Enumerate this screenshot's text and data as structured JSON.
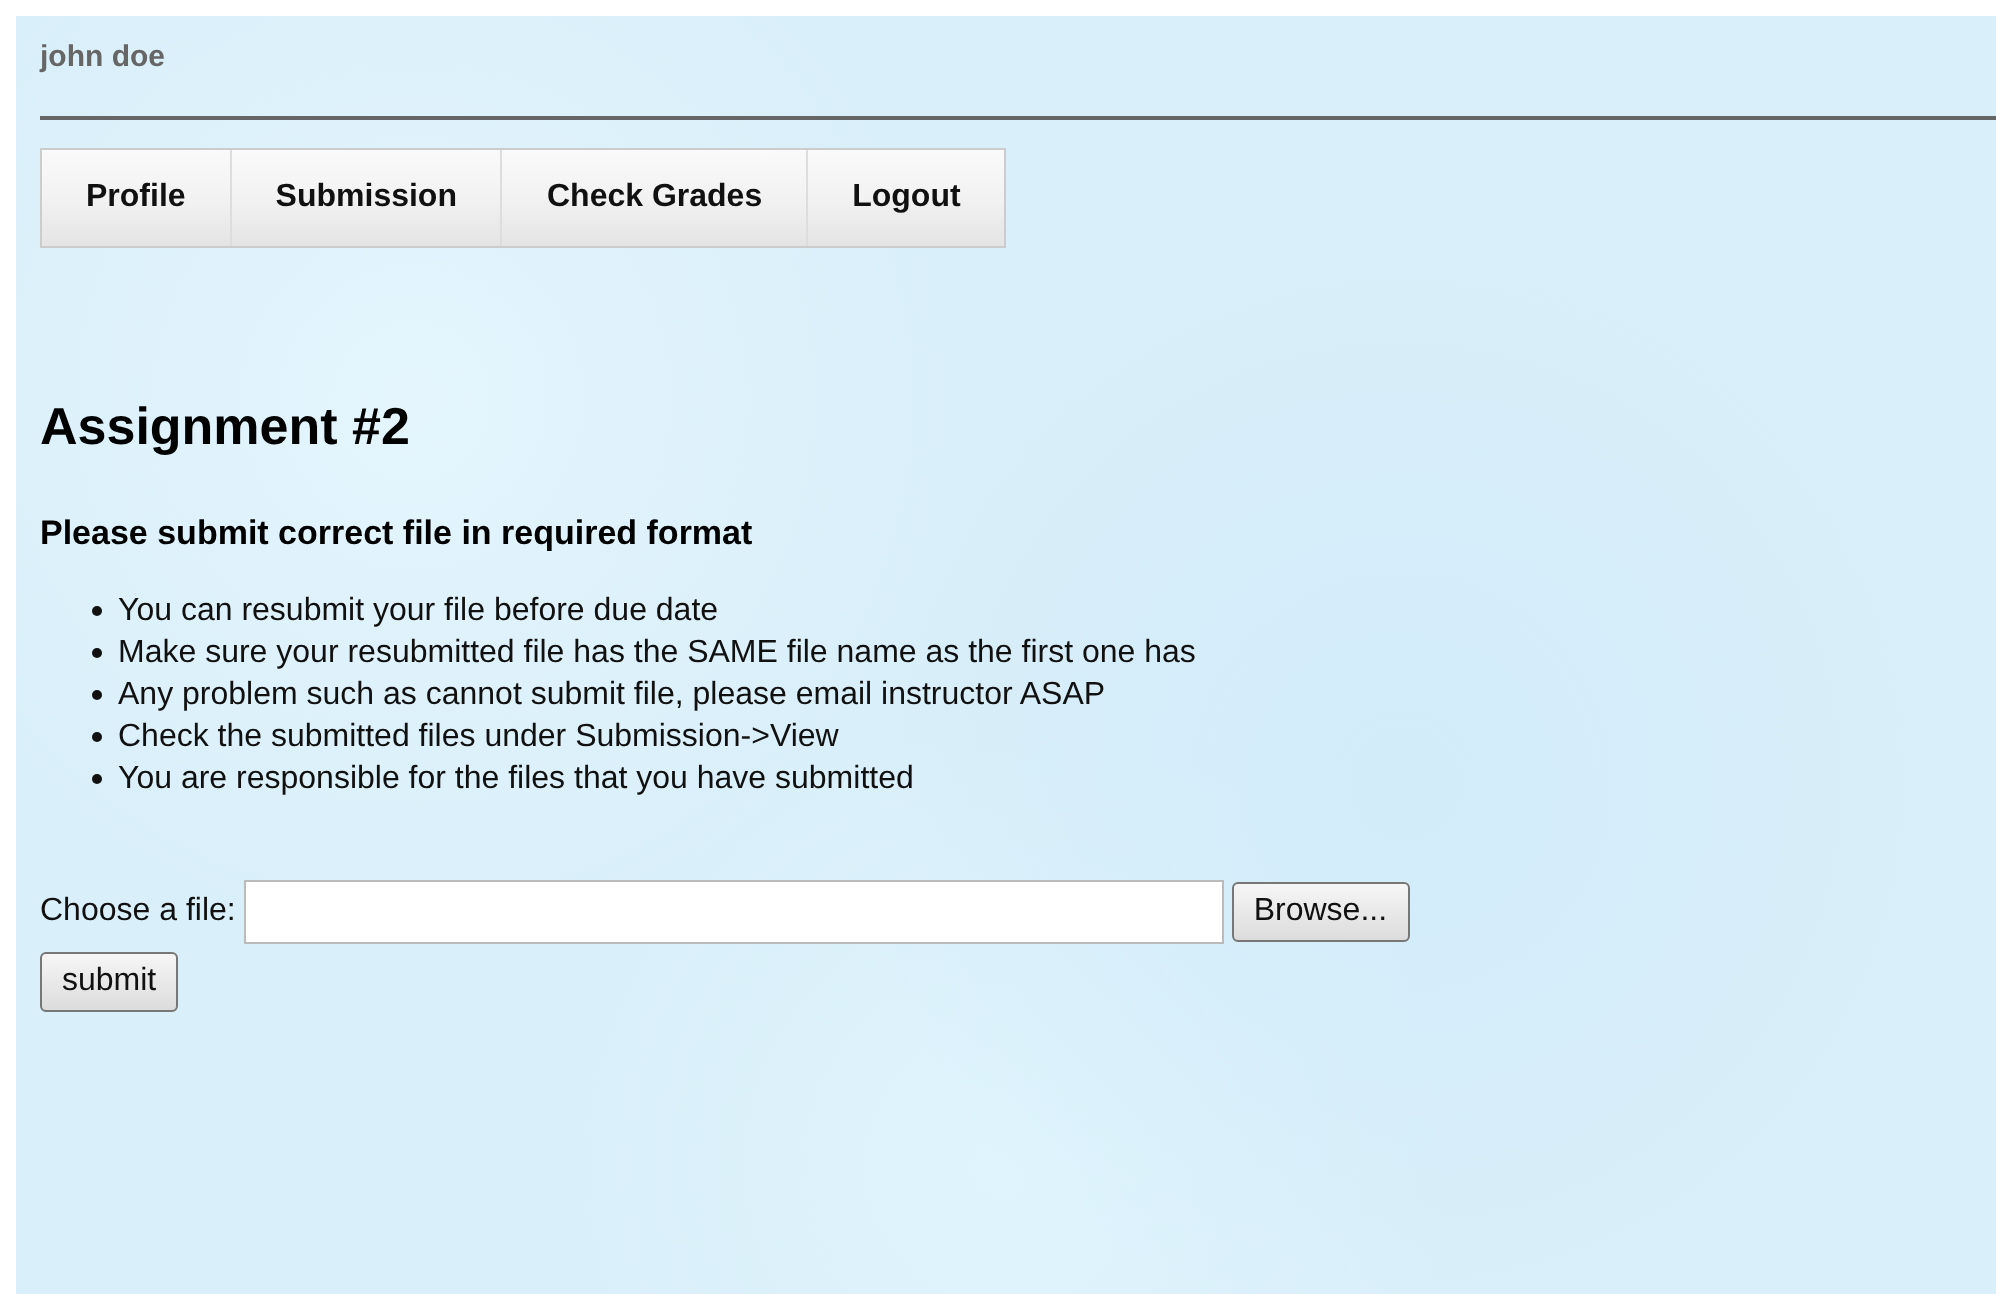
{
  "user": {
    "name": "john doe"
  },
  "tabs": [
    {
      "label": "Profile"
    },
    {
      "label": "Submission"
    },
    {
      "label": "Check Grades"
    },
    {
      "label": "Logout"
    }
  ],
  "heading": "Assignment #2",
  "subheading": "Please submit correct file in required format",
  "notes": [
    "You can resubmit your file before due date",
    "Make sure your resubmitted file has the SAME file name as the first one has",
    "Any problem such as cannot submit file, please email instructor ASAP",
    "Check the submitted files under Submission->View",
    "You are responsible for the files that you have submitted"
  ],
  "file_field": {
    "label": "Choose a file:",
    "browse_button": "Browse..."
  },
  "submit_button": "submit"
}
